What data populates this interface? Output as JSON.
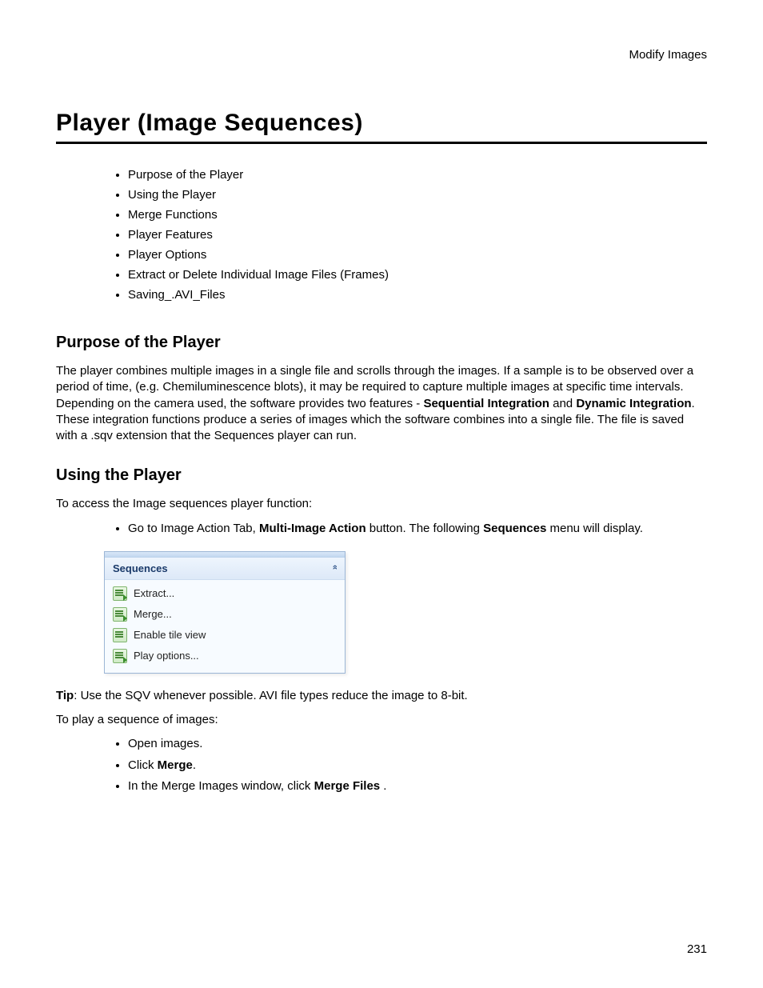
{
  "header": {
    "section": "Modify Images"
  },
  "title": "Player (Image Sequences)",
  "toc": [
    "Purpose of the Player",
    "Using the Player",
    "Merge Functions",
    "Player Features",
    "Player Options",
    "Extract or Delete Individual Image Files (Frames)",
    "Saving_.AVI_Files"
  ],
  "purpose": {
    "heading": "Purpose of the Player",
    "p1a": "The player combines multiple images in a single file and scrolls through the images. If a sample is to be observed over a period of time, (e.g. Chemiluminescence blots), it may be required to capture multiple images at specific time intervals. Depending on the camera used, the software provides two features - ",
    "p1b_bold1": "Sequential Integration",
    "p1c": " and ",
    "p1d_bold2": "Dynamic Integration",
    "p1e": ". These integration functions produce a series of images which the software combines into a single file. The file is saved with a .sqv extension that the Sequences player can run."
  },
  "using": {
    "heading": "Using the Player",
    "lead": "To access the Image sequences player function:",
    "step1_a": "Go to Image Action Tab, ",
    "step1_b_bold": "Multi-Image Action",
    "step1_c": " button. The following ",
    "step1_d_bold": "Sequences",
    "step1_e": " menu will display."
  },
  "panel": {
    "title": "Sequences",
    "items": [
      "Extract...",
      "Merge...",
      "Enable tile view",
      "Play options..."
    ]
  },
  "tip": {
    "label": "Tip",
    "text": ": Use the SQV whenever possible. AVI file types reduce the image to 8-bit."
  },
  "play": {
    "lead": "To play a sequence of images:",
    "s1": "Open images.",
    "s2a": "Click ",
    "s2b_bold": "Merge",
    "s2c": ".",
    "s3a": "In the Merge Images window, click ",
    "s3b_bold": "Merge Files",
    "s3c": " ."
  },
  "page_number": "231"
}
